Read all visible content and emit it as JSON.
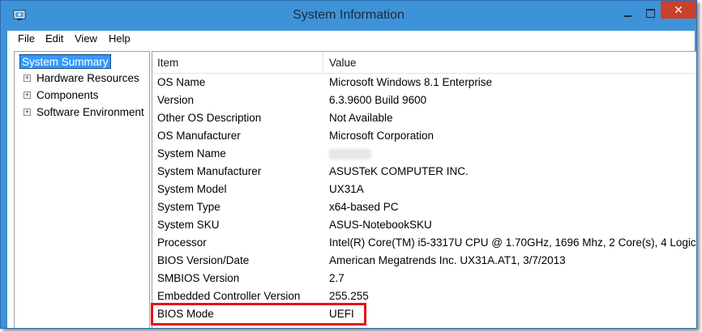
{
  "window": {
    "title": "System Information",
    "accent": "#3e93d8",
    "close_color": "#c9402b",
    "minimize_glyph": "minimize",
    "maximize_glyph": "maximize",
    "close_glyph": "✕"
  },
  "menu": {
    "items": [
      "File",
      "Edit",
      "View",
      "Help"
    ]
  },
  "tree": {
    "selected": "System Summary",
    "children": [
      {
        "expander": "+",
        "label": "Hardware Resources"
      },
      {
        "expander": "+",
        "label": "Components"
      },
      {
        "expander": "+",
        "label": "Software Environment"
      }
    ]
  },
  "table": {
    "headers": {
      "item": "Item",
      "value": "Value"
    },
    "rows": [
      {
        "item": "OS Name",
        "value": "Microsoft Windows 8.1 Enterprise"
      },
      {
        "item": "Version",
        "value": "6.3.9600 Build 9600"
      },
      {
        "item": "Other OS Description",
        "value": "Not Available"
      },
      {
        "item": "OS Manufacturer",
        "value": "Microsoft Corporation"
      },
      {
        "item": "System Name",
        "value": ""
      },
      {
        "item": "System Manufacturer",
        "value": "ASUSTeK COMPUTER INC."
      },
      {
        "item": "System Model",
        "value": "UX31A"
      },
      {
        "item": "System Type",
        "value": "x64-based PC"
      },
      {
        "item": "System SKU",
        "value": "ASUS-NotebookSKU"
      },
      {
        "item": "Processor",
        "value": "Intel(R) Core(TM) i5-3317U CPU @ 1.70GHz, 1696 Mhz, 2 Core(s), 4 Logica"
      },
      {
        "item": "BIOS Version/Date",
        "value": "American Megatrends Inc. UX31A.AT1, 3/7/2013"
      },
      {
        "item": "SMBIOS Version",
        "value": "2.7"
      },
      {
        "item": "Embedded Controller Version",
        "value": "255.255"
      },
      {
        "item": "BIOS Mode",
        "value": "UEFI"
      }
    ]
  },
  "annotation": {
    "highlight_color": "#e3131b",
    "highlighted_row": "BIOS Mode"
  }
}
